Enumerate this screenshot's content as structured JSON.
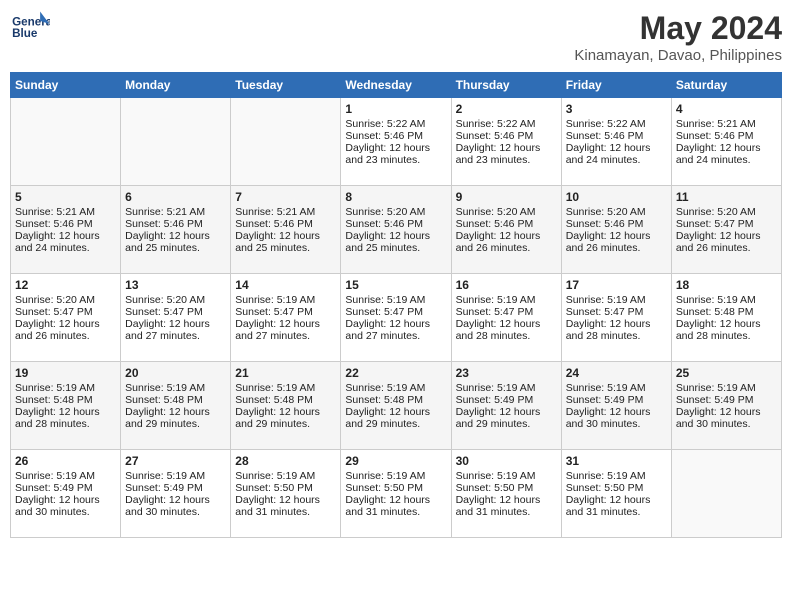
{
  "header": {
    "logo_line1": "General",
    "logo_line2": "Blue",
    "month_year": "May 2024",
    "location": "Kinamayan, Davao, Philippines"
  },
  "weekdays": [
    "Sunday",
    "Monday",
    "Tuesday",
    "Wednesday",
    "Thursday",
    "Friday",
    "Saturday"
  ],
  "weeks": [
    [
      {
        "day": "",
        "sunrise": "",
        "sunset": "",
        "daylight": ""
      },
      {
        "day": "",
        "sunrise": "",
        "sunset": "",
        "daylight": ""
      },
      {
        "day": "",
        "sunrise": "",
        "sunset": "",
        "daylight": ""
      },
      {
        "day": "1",
        "sunrise": "Sunrise: 5:22 AM",
        "sunset": "Sunset: 5:46 PM",
        "daylight": "Daylight: 12 hours and 23 minutes."
      },
      {
        "day": "2",
        "sunrise": "Sunrise: 5:22 AM",
        "sunset": "Sunset: 5:46 PM",
        "daylight": "Daylight: 12 hours and 23 minutes."
      },
      {
        "day": "3",
        "sunrise": "Sunrise: 5:22 AM",
        "sunset": "Sunset: 5:46 PM",
        "daylight": "Daylight: 12 hours and 24 minutes."
      },
      {
        "day": "4",
        "sunrise": "Sunrise: 5:21 AM",
        "sunset": "Sunset: 5:46 PM",
        "daylight": "Daylight: 12 hours and 24 minutes."
      }
    ],
    [
      {
        "day": "5",
        "sunrise": "Sunrise: 5:21 AM",
        "sunset": "Sunset: 5:46 PM",
        "daylight": "Daylight: 12 hours and 24 minutes."
      },
      {
        "day": "6",
        "sunrise": "Sunrise: 5:21 AM",
        "sunset": "Sunset: 5:46 PM",
        "daylight": "Daylight: 12 hours and 25 minutes."
      },
      {
        "day": "7",
        "sunrise": "Sunrise: 5:21 AM",
        "sunset": "Sunset: 5:46 PM",
        "daylight": "Daylight: 12 hours and 25 minutes."
      },
      {
        "day": "8",
        "sunrise": "Sunrise: 5:20 AM",
        "sunset": "Sunset: 5:46 PM",
        "daylight": "Daylight: 12 hours and 25 minutes."
      },
      {
        "day": "9",
        "sunrise": "Sunrise: 5:20 AM",
        "sunset": "Sunset: 5:46 PM",
        "daylight": "Daylight: 12 hours and 26 minutes."
      },
      {
        "day": "10",
        "sunrise": "Sunrise: 5:20 AM",
        "sunset": "Sunset: 5:46 PM",
        "daylight": "Daylight: 12 hours and 26 minutes."
      },
      {
        "day": "11",
        "sunrise": "Sunrise: 5:20 AM",
        "sunset": "Sunset: 5:47 PM",
        "daylight": "Daylight: 12 hours and 26 minutes."
      }
    ],
    [
      {
        "day": "12",
        "sunrise": "Sunrise: 5:20 AM",
        "sunset": "Sunset: 5:47 PM",
        "daylight": "Daylight: 12 hours and 26 minutes."
      },
      {
        "day": "13",
        "sunrise": "Sunrise: 5:20 AM",
        "sunset": "Sunset: 5:47 PM",
        "daylight": "Daylight: 12 hours and 27 minutes."
      },
      {
        "day": "14",
        "sunrise": "Sunrise: 5:19 AM",
        "sunset": "Sunset: 5:47 PM",
        "daylight": "Daylight: 12 hours and 27 minutes."
      },
      {
        "day": "15",
        "sunrise": "Sunrise: 5:19 AM",
        "sunset": "Sunset: 5:47 PM",
        "daylight": "Daylight: 12 hours and 27 minutes."
      },
      {
        "day": "16",
        "sunrise": "Sunrise: 5:19 AM",
        "sunset": "Sunset: 5:47 PM",
        "daylight": "Daylight: 12 hours and 28 minutes."
      },
      {
        "day": "17",
        "sunrise": "Sunrise: 5:19 AM",
        "sunset": "Sunset: 5:47 PM",
        "daylight": "Daylight: 12 hours and 28 minutes."
      },
      {
        "day": "18",
        "sunrise": "Sunrise: 5:19 AM",
        "sunset": "Sunset: 5:48 PM",
        "daylight": "Daylight: 12 hours and 28 minutes."
      }
    ],
    [
      {
        "day": "19",
        "sunrise": "Sunrise: 5:19 AM",
        "sunset": "Sunset: 5:48 PM",
        "daylight": "Daylight: 12 hours and 28 minutes."
      },
      {
        "day": "20",
        "sunrise": "Sunrise: 5:19 AM",
        "sunset": "Sunset: 5:48 PM",
        "daylight": "Daylight: 12 hours and 29 minutes."
      },
      {
        "day": "21",
        "sunrise": "Sunrise: 5:19 AM",
        "sunset": "Sunset: 5:48 PM",
        "daylight": "Daylight: 12 hours and 29 minutes."
      },
      {
        "day": "22",
        "sunrise": "Sunrise: 5:19 AM",
        "sunset": "Sunset: 5:48 PM",
        "daylight": "Daylight: 12 hours and 29 minutes."
      },
      {
        "day": "23",
        "sunrise": "Sunrise: 5:19 AM",
        "sunset": "Sunset: 5:49 PM",
        "daylight": "Daylight: 12 hours and 29 minutes."
      },
      {
        "day": "24",
        "sunrise": "Sunrise: 5:19 AM",
        "sunset": "Sunset: 5:49 PM",
        "daylight": "Daylight: 12 hours and 30 minutes."
      },
      {
        "day": "25",
        "sunrise": "Sunrise: 5:19 AM",
        "sunset": "Sunset: 5:49 PM",
        "daylight": "Daylight: 12 hours and 30 minutes."
      }
    ],
    [
      {
        "day": "26",
        "sunrise": "Sunrise: 5:19 AM",
        "sunset": "Sunset: 5:49 PM",
        "daylight": "Daylight: 12 hours and 30 minutes."
      },
      {
        "day": "27",
        "sunrise": "Sunrise: 5:19 AM",
        "sunset": "Sunset: 5:49 PM",
        "daylight": "Daylight: 12 hours and 30 minutes."
      },
      {
        "day": "28",
        "sunrise": "Sunrise: 5:19 AM",
        "sunset": "Sunset: 5:50 PM",
        "daylight": "Daylight: 12 hours and 31 minutes."
      },
      {
        "day": "29",
        "sunrise": "Sunrise: 5:19 AM",
        "sunset": "Sunset: 5:50 PM",
        "daylight": "Daylight: 12 hours and 31 minutes."
      },
      {
        "day": "30",
        "sunrise": "Sunrise: 5:19 AM",
        "sunset": "Sunset: 5:50 PM",
        "daylight": "Daylight: 12 hours and 31 minutes."
      },
      {
        "day": "31",
        "sunrise": "Sunrise: 5:19 AM",
        "sunset": "Sunset: 5:50 PM",
        "daylight": "Daylight: 12 hours and 31 minutes."
      },
      {
        "day": "",
        "sunrise": "",
        "sunset": "",
        "daylight": ""
      }
    ]
  ]
}
